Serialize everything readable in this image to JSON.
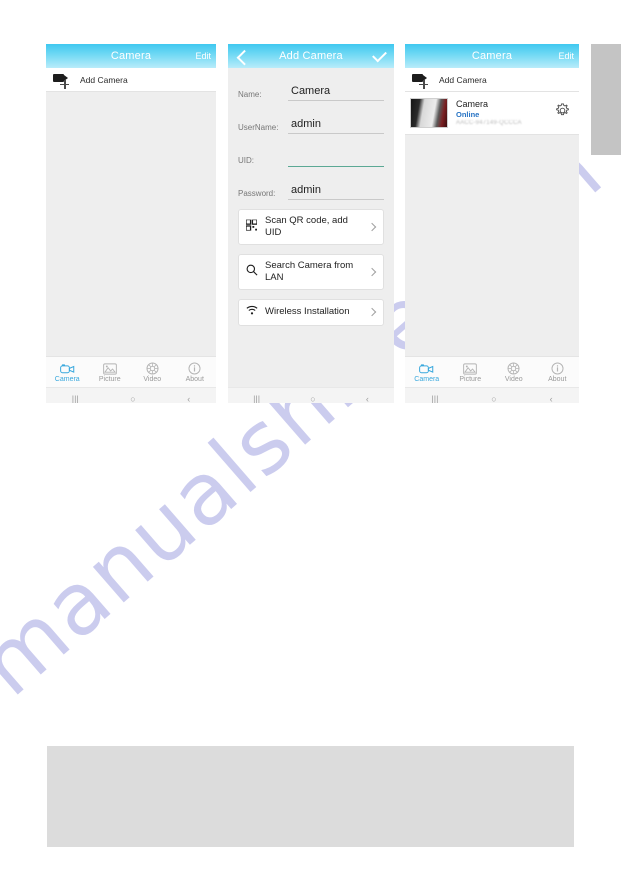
{
  "watermark": {
    "text": "manualshive.com"
  },
  "phone1": {
    "header": {
      "title": "Camera",
      "edit_label": "Edit"
    },
    "add_row": {
      "label": "Add Camera",
      "icon": "camcorder-add-icon"
    },
    "tabs": [
      {
        "label": "Camera",
        "icon": "camera-icon",
        "active": true
      },
      {
        "label": "Picture",
        "icon": "picture-icon",
        "active": false
      },
      {
        "label": "Video",
        "icon": "video-icon",
        "active": false
      },
      {
        "label": "About",
        "icon": "info-icon",
        "active": false
      }
    ],
    "android_nav": {
      "recent": "|||",
      "home": "○",
      "back": "‹"
    }
  },
  "phone2": {
    "header": {
      "title": "Add Camera",
      "back_icon": "chevron-left-icon",
      "confirm_icon": "check-icon"
    },
    "fields": [
      {
        "label": "Name:",
        "value": "Camera",
        "focused": false
      },
      {
        "label": "UserName:",
        "value": "admin",
        "focused": false
      },
      {
        "label": "UID:",
        "value": "",
        "focused": true
      },
      {
        "label": "Password:",
        "value": "admin",
        "focused": false
      }
    ],
    "actions": [
      {
        "label": "Scan QR code, add UID",
        "icon": "qr-code-icon"
      },
      {
        "label": "Search Camera from LAN",
        "icon": "search-icon"
      },
      {
        "label": "Wireless Installation",
        "icon": "wifi-icon"
      }
    ],
    "android_nav": {
      "recent": "|||",
      "home": "○",
      "back": "‹"
    }
  },
  "phone3": {
    "header": {
      "title": "Camera",
      "edit_label": "Edit"
    },
    "add_row": {
      "label": "Add Camera",
      "icon": "camcorder-add-icon"
    },
    "camera_entry": {
      "name": "Camera",
      "status": "Online",
      "uid": "AACC-947149-QCCCA",
      "settings_icon": "gear-icon"
    },
    "tabs": [
      {
        "label": "Camera",
        "icon": "camera-icon",
        "active": true
      },
      {
        "label": "Picture",
        "icon": "picture-icon",
        "active": false
      },
      {
        "label": "Video",
        "icon": "video-icon",
        "active": false
      },
      {
        "label": "About",
        "icon": "info-icon",
        "active": false
      }
    ],
    "android_nav": {
      "recent": "|||",
      "home": "○",
      "back": "‹"
    }
  },
  "colors": {
    "header_gradient_start": "#3fc8f0",
    "header_gradient_end": "#b8ecfa",
    "accent_blue": "#39a8dd",
    "status_online": "#2673c4",
    "focus_underline": "#5ba894",
    "watermark": "#c9caee",
    "panel_grey": "#dcdcdc",
    "side_tab_grey": "#c4c4c4"
  }
}
